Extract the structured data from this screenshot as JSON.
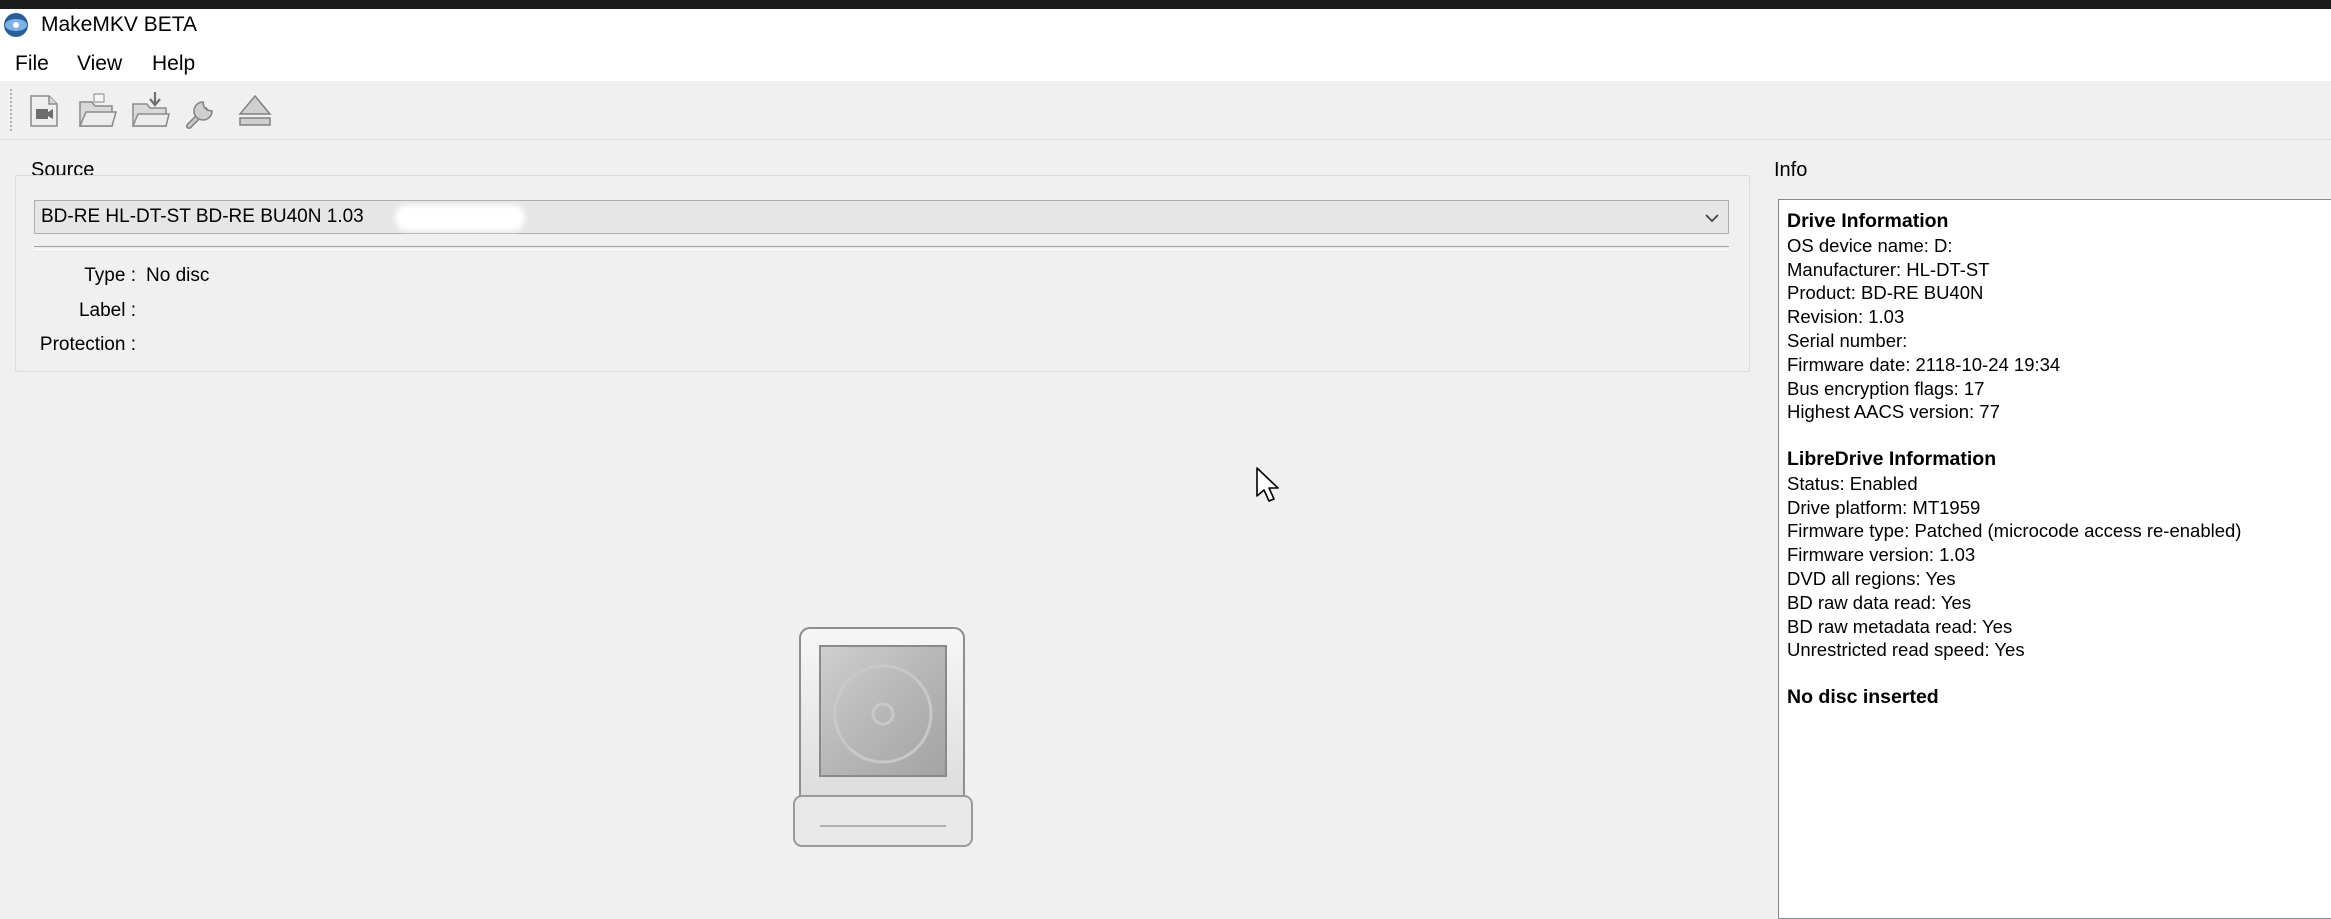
{
  "window": {
    "title": "MakeMKV BETA"
  },
  "menu": {
    "items": [
      "File",
      "View",
      "Help"
    ]
  },
  "toolbar": {
    "buttons": [
      "open-files-icon",
      "open-folder-icon",
      "save-backup-icon",
      "preferences-wrench-icon",
      "eject-icon"
    ]
  },
  "source": {
    "group_label": "Source",
    "drive_selected": "BD-RE HL-DT-ST BD-RE BU40N 1.03",
    "type_label": "Type :",
    "type_value": "No disc",
    "label_label": "Label :",
    "label_value": "",
    "protection_label": "Protection :",
    "protection_value": ""
  },
  "info": {
    "group_label": "Info",
    "drive_heading": "Drive Information",
    "drive_lines": [
      "OS device name: D:",
      "Manufacturer: HL-DT-ST",
      "Product: BD-RE BU40N",
      "Revision: 1.03",
      "Serial number:",
      "Firmware date: 2118-10-24 19:34",
      "Bus encryption flags: 17",
      "Highest AACS version: 77"
    ],
    "libredrive_heading": "LibreDrive Information",
    "libredrive_lines": [
      "Status: Enabled",
      "Drive platform: MT1959",
      "Firmware type: Patched (microcode access re-enabled)",
      "Firmware version: 1.03",
      "DVD all regions: Yes",
      "BD raw data read: Yes",
      "BD raw metadata read: Yes",
      "Unrestricted read speed: Yes"
    ],
    "disc_status": "No disc inserted"
  }
}
